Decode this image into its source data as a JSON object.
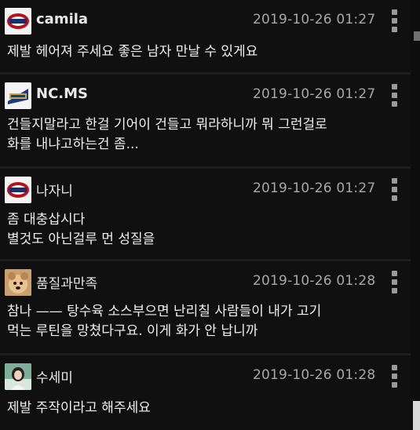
{
  "comments": [
    {
      "author": "camila",
      "timestamp": "2019-10-26 01:27",
      "lines": [
        "제발 헤어져 주세요 좋은 남자 만날 수 있게요"
      ],
      "avatar_icon": "team-logo-icon"
    },
    {
      "author": "NC.MS",
      "timestamp": "2019-10-26 01:27",
      "lines": [
        "건들지말라고 한걸 기어이 건들고 뭐라하니까 뭐 그런걸로",
        "화를 내냐고하는건 좀..."
      ],
      "avatar_icon": "team-logo-icon"
    },
    {
      "author": "나자니",
      "timestamp": "2019-10-26 01:27",
      "lines": [
        "좀 대충삽시다",
        "별것도 아닌걸루 먼 성질을"
      ],
      "avatar_icon": "team-logo-icon"
    },
    {
      "author": "품질과만족",
      "timestamp": "2019-10-26 01:28",
      "lines": [
        "참나 —— 탕수육 소스부으면 난리칠 사람들이 내가 고기",
        "먹는 루틴을 망쳤다구요. 이게 화가 안 납니까"
      ],
      "avatar_icon": "dog-photo-icon"
    },
    {
      "author": "수세미",
      "timestamp": "2019-10-26 01:28",
      "lines": [
        "제발 주작이라고 해주세요"
      ],
      "avatar_icon": "person-photo-icon"
    }
  ],
  "colors": {
    "background": "#0d0d0d",
    "card": "#101010",
    "divider": "#1f1f1f",
    "text": "#f0f0f0",
    "timestamp": "#a8a8a8"
  }
}
